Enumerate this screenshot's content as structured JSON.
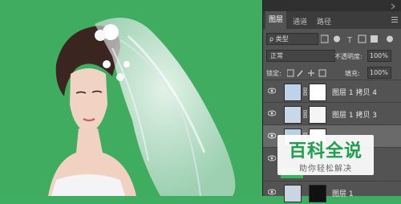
{
  "panel": {
    "tabs": [
      {
        "label": "图层"
      },
      {
        "label": "通道"
      },
      {
        "label": "路径"
      }
    ],
    "filter": {
      "kind": "ρ 类型"
    },
    "blend": {
      "mode": "正常",
      "opacity_label": "不透明度:",
      "opacity_value": "100%"
    },
    "lock": {
      "label": "锁定:",
      "fill_label": "填充:",
      "fill_value": "100%"
    },
    "layers": [
      {
        "name": "图层 1 拷贝 4"
      },
      {
        "name": "图层 1 拷贝 3"
      },
      {
        "name": ""
      },
      {
        "name": ""
      },
      {
        "name": "图层 1"
      }
    ]
  },
  "watermark": {
    "title": "百科全说",
    "subtitle": "助你轻松解决"
  }
}
